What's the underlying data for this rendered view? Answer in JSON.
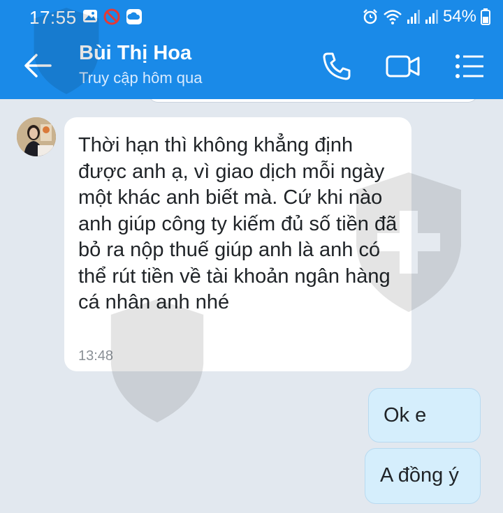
{
  "status_bar": {
    "time": "17:55",
    "battery": "54%",
    "icons_left": [
      "gallery-icon",
      "blocked-icon",
      "cloud-icon"
    ],
    "icons_right": [
      "alarm-icon",
      "wifi-icon",
      "signal-icon",
      "signal-icon",
      "battery-icon"
    ]
  },
  "header": {
    "back_icon": "back-arrow-icon",
    "contact_name": "Bùi Thị Hoa",
    "contact_status": "Truy cập hôm qua",
    "actions": [
      "phone-icon",
      "video-call-icon",
      "menu-icon"
    ]
  },
  "messages": [
    {
      "direction": "incoming",
      "text": "Thời hạn thì không khẳng định được anh ạ, vì giao dịch mỗi ngày một khác anh biết mà. Cứ khi nào anh giúp công ty kiếm đủ số tiền đã bỏ ra nộp thuế giúp anh là anh có thể rút tiền về tài khoản ngân hàng cá nhân anh nhé",
      "time": "13:48"
    },
    {
      "direction": "outgoing",
      "text": "Ok e"
    },
    {
      "direction": "outgoing",
      "text": "A đồng ý"
    }
  ],
  "colors": {
    "header_bg": "#1a8ae8",
    "chat_bg": "#e2e8ef",
    "incoming_bubble": "#ffffff",
    "outgoing_bubble": "#d5eefc"
  }
}
